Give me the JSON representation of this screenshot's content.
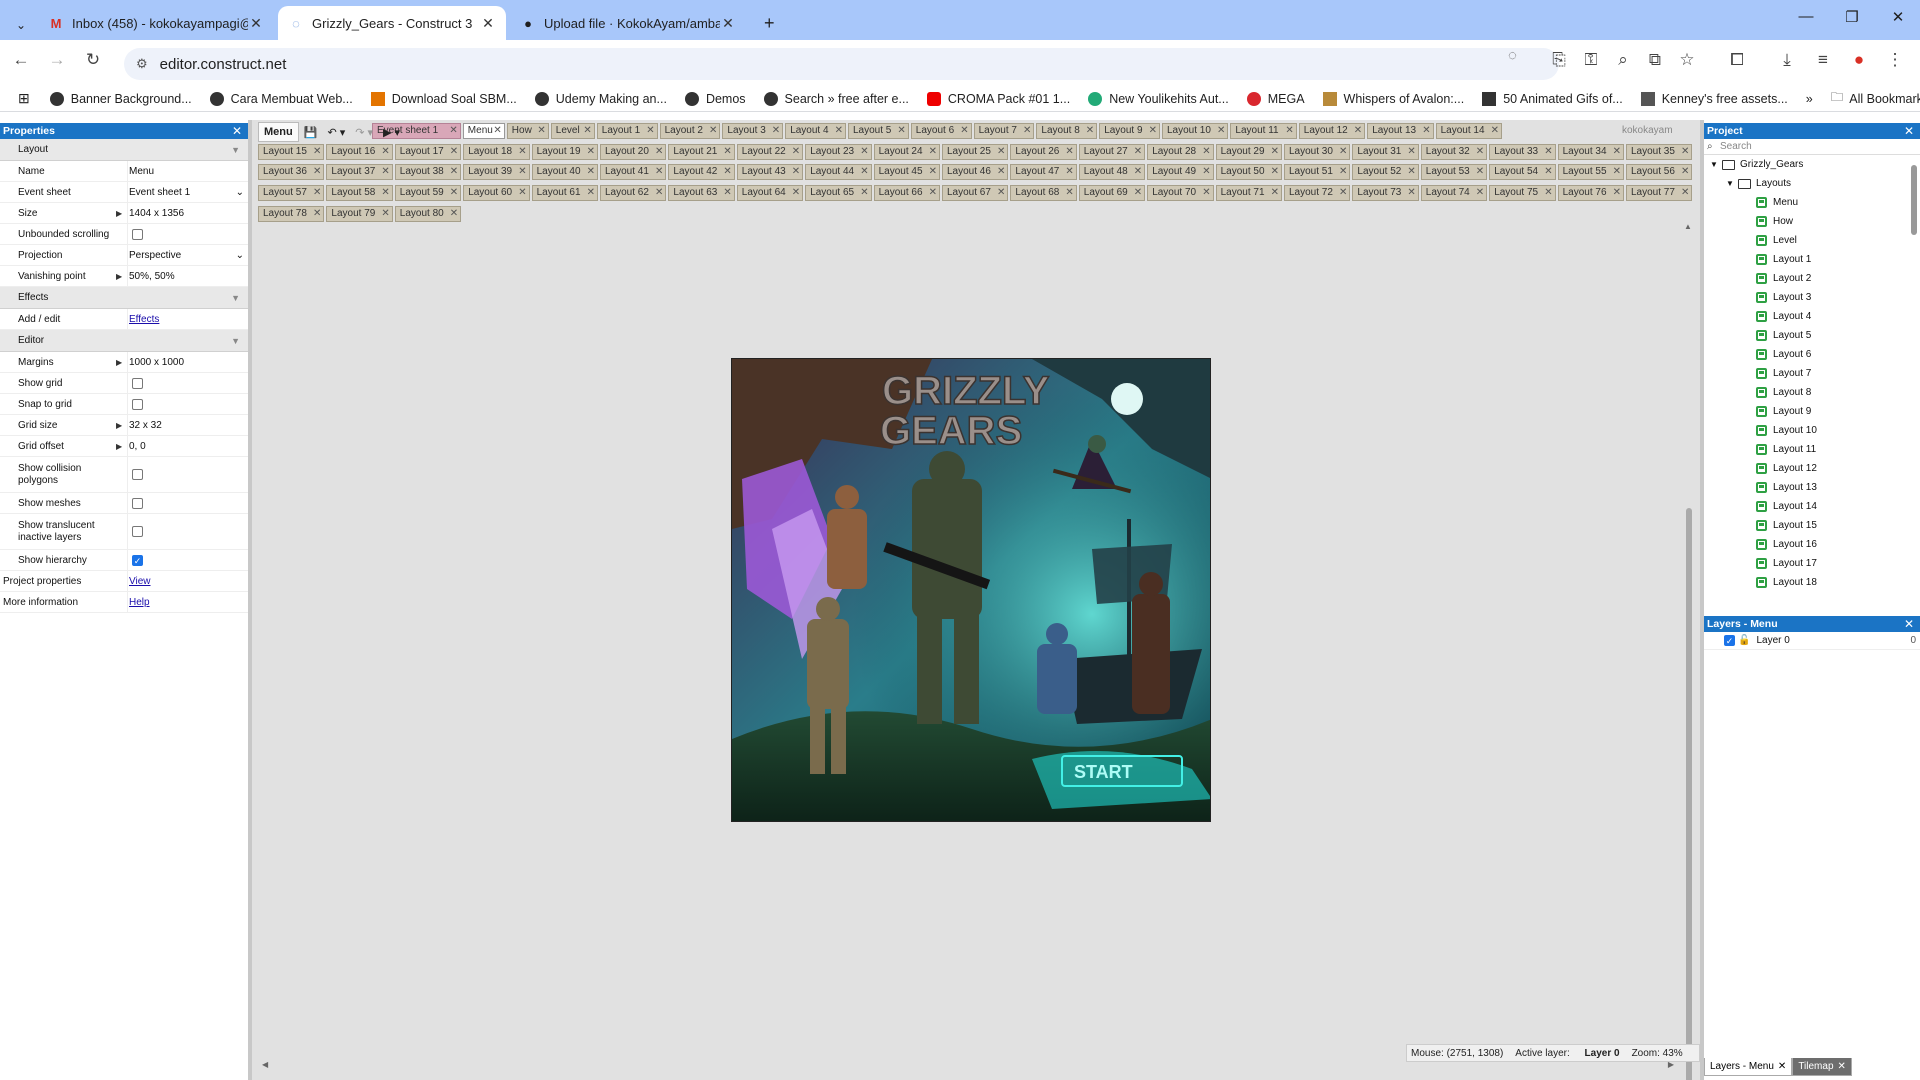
{
  "browser": {
    "tabs": [
      {
        "title": "Inbox (458) - kokokayampagi@",
        "icon": "gmail-icon",
        "active": false
      },
      {
        "title": "Grizzly_Gears - Construct 3",
        "icon": "loading-icon",
        "active": true
      },
      {
        "title": "Upload file · KokokAyam/amba",
        "icon": "github-icon",
        "active": false
      }
    ],
    "new_tab": "+",
    "url": "editor.construct.net",
    "bookmarks": [
      "Banner Background...",
      "Cara Membuat Web...",
      "Download Soal SBM...",
      "Udemy Making an...",
      "Demos",
      "Search » free after e...",
      "CROMA Pack #01 1...",
      "New Youlikehits Aut...",
      "MEGA",
      "Whispers of Avalon:...",
      "50 Animated Gifs of...",
      "Kenney's free assets..."
    ],
    "bookmarks_more": "»",
    "all_bookmarks": "All Bookmarks"
  },
  "properties": {
    "title": "Properties",
    "sections": {
      "layout": "Layout",
      "effects": "Effects",
      "editor": "Editor"
    },
    "rows": {
      "name": {
        "label": "Name",
        "value": "Menu"
      },
      "event_sheet": {
        "label": "Event sheet",
        "value": "Event sheet 1"
      },
      "size": {
        "label": "Size",
        "value": "1404 x 1356"
      },
      "unbounded": {
        "label": "Unbounded scrolling",
        "checked": false
      },
      "projection": {
        "label": "Projection",
        "value": "Perspective"
      },
      "vanishing": {
        "label": "Vanishing point",
        "value": "50%, 50%"
      },
      "add_edit": {
        "label": "Add / edit",
        "value": "Effects"
      },
      "margins": {
        "label": "Margins",
        "value": "1000 x 1000"
      },
      "show_grid": {
        "label": "Show grid",
        "checked": false
      },
      "snap_grid": {
        "label": "Snap to grid",
        "checked": false
      },
      "grid_size": {
        "label": "Grid size",
        "value": "32 x 32"
      },
      "grid_offset": {
        "label": "Grid offset",
        "value": "0, 0"
      },
      "collision": {
        "label1": "Show collision",
        "label2": "polygons",
        "checked": false
      },
      "meshes": {
        "label": "Show meshes",
        "checked": false
      },
      "translucent": {
        "label1": "Show translucent",
        "label2": "inactive layers",
        "checked": false
      },
      "hierarchy": {
        "label": "Show hierarchy",
        "checked": true
      },
      "project_props": {
        "label": "Project properties",
        "value": "View"
      },
      "more_info": {
        "label": "More information",
        "value": "Help"
      }
    }
  },
  "editor": {
    "menu_label": "Menu",
    "user": "kokokayam",
    "tabs_row1": [
      "Event sheet 1",
      "Menu",
      "How",
      "Level",
      "Layout 1",
      "Layout 2",
      "Layout 3",
      "Layout 4",
      "Layout 5",
      "Layout 6",
      "Layout 7",
      "Layout 8",
      "Layout 9",
      "Layout 10",
      "Layout 11",
      "Layout 12",
      "Layout 13",
      "Layout 14"
    ],
    "tabs_row2": [
      "Layout 15",
      "Layout 16",
      "Layout 17",
      "Layout 18",
      "Layout 19",
      "Layout 20",
      "Layout 21",
      "Layout 22",
      "Layout 23",
      "Layout 24",
      "Layout 25",
      "Layout 26",
      "Layout 27",
      "Layout 28",
      "Layout 29",
      "Layout 30",
      "Layout 31",
      "Layout 32",
      "Layout 33",
      "Layout 34",
      "Layout 35"
    ],
    "tabs_row3": [
      "Layout 36",
      "Layout 37",
      "Layout 38",
      "Layout 39",
      "Layout 40",
      "Layout 41",
      "Layout 42",
      "Layout 43",
      "Layout 44",
      "Layout 45",
      "Layout 46",
      "Layout 47",
      "Layout 48",
      "Layout 49",
      "Layout 50",
      "Layout 51",
      "Layout 52",
      "Layout 53",
      "Layout 54",
      "Layout 55",
      "Layout 56"
    ],
    "tabs_row4": [
      "Layout 57",
      "Layout 58",
      "Layout 59",
      "Layout 60",
      "Layout 61",
      "Layout 62",
      "Layout 63",
      "Layout 64",
      "Layout 65",
      "Layout 66",
      "Layout 67",
      "Layout 68",
      "Layout 69",
      "Layout 70",
      "Layout 71",
      "Layout 72",
      "Layout 73",
      "Layout 74",
      "Layout 75",
      "Layout 76",
      "Layout 77"
    ],
    "tabs_row5": [
      "Layout 78",
      "Layout 79",
      "Layout 80"
    ],
    "canvas": {
      "title_line1": "GRIZZLY",
      "title_line2": "GEARS",
      "start": "START"
    },
    "status": {
      "mouse": "Mouse: (2751, 1308)",
      "active_label": "Active layer:",
      "active_value": "Layer 0",
      "zoom": "Zoom: 43%"
    }
  },
  "project": {
    "title": "Project",
    "search_placeholder": "Search",
    "root": "Grizzly_Gears",
    "folder": "Layouts",
    "items": [
      "Menu",
      "How",
      "Level",
      "Layout 1",
      "Layout 2",
      "Layout 3",
      "Layout 4",
      "Layout 5",
      "Layout 6",
      "Layout 7",
      "Layout 8",
      "Layout 9",
      "Layout 10",
      "Layout 11",
      "Layout 12",
      "Layout 13",
      "Layout 14",
      "Layout 15",
      "Layout 16",
      "Layout 17",
      "Layout 18"
    ]
  },
  "layers": {
    "title": "Layers - Menu",
    "items": [
      {
        "name": "Layer 0",
        "index": "0"
      }
    ],
    "bottom_tabs": [
      "Layers - Menu",
      "Tilemap"
    ]
  },
  "colors": {
    "panel_header": "#1b74c5",
    "chrome_tab_bg": "#a8c7fa",
    "layout_tab": "#cfc8b5",
    "event_tab": "#d9a7b8"
  }
}
